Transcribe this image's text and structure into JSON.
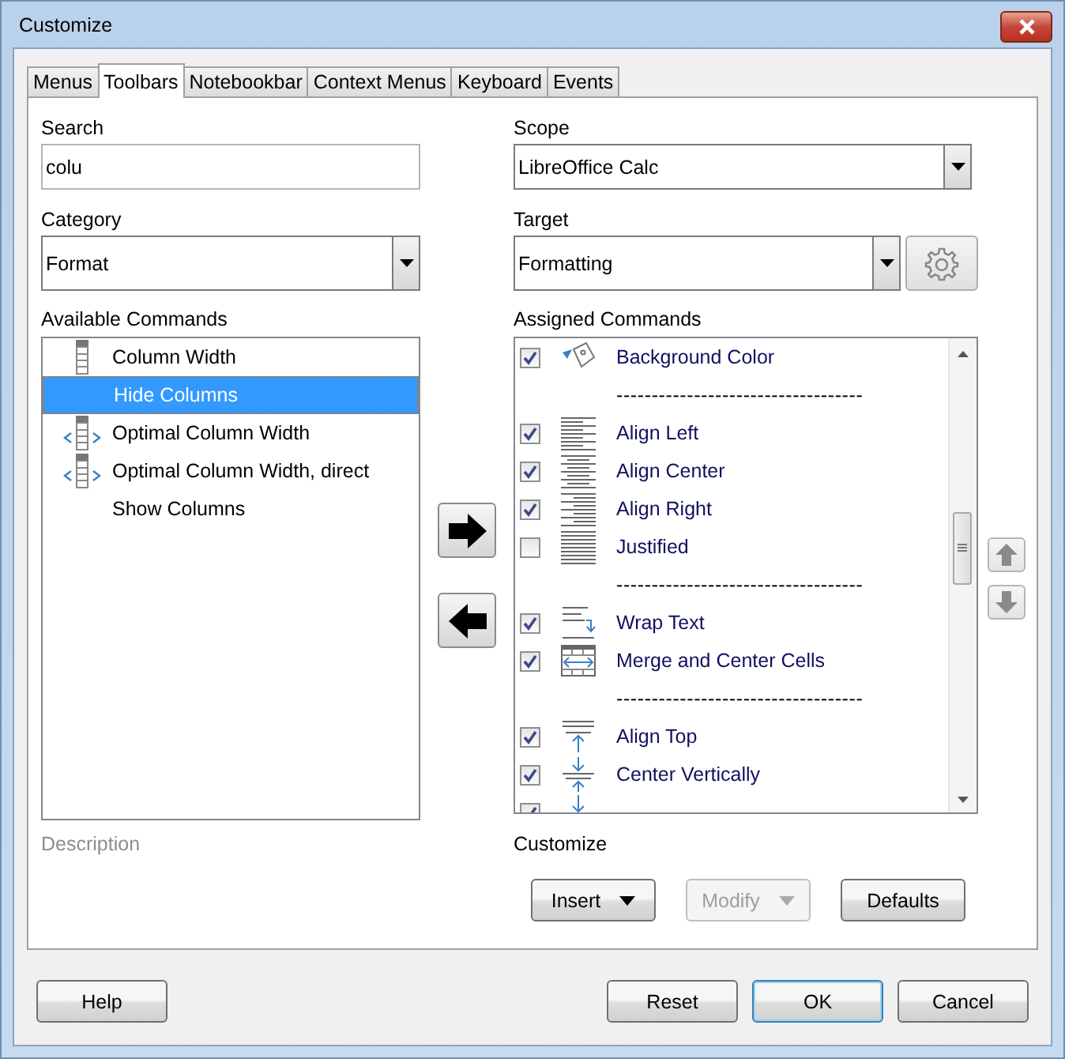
{
  "window": {
    "title": "Customize"
  },
  "tabs": [
    {
      "label": "Menus",
      "selected": false
    },
    {
      "label": "Toolbars",
      "selected": true
    },
    {
      "label": "Notebookbar",
      "selected": false
    },
    {
      "label": "Context Menus",
      "selected": false
    },
    {
      "label": "Keyboard",
      "selected": false
    },
    {
      "label": "Events",
      "selected": false
    }
  ],
  "search": {
    "label": "Search",
    "value": "colu"
  },
  "category": {
    "label": "Category",
    "value": "Format"
  },
  "available_commands": {
    "label": "Available Commands",
    "items": [
      {
        "label": "Column Width",
        "selected": false
      },
      {
        "label": "Hide Columns",
        "selected": true
      },
      {
        "label": "Optimal Column Width",
        "selected": false
      },
      {
        "label": "Optimal Column Width, direct",
        "selected": false
      },
      {
        "label": "Show Columns",
        "selected": false
      }
    ]
  },
  "description": {
    "label": "Description",
    "disabled": true
  },
  "scope": {
    "label": "Scope",
    "value": "LibreOffice Calc"
  },
  "target": {
    "label": "Target",
    "value": "Formatting"
  },
  "assigned_commands": {
    "label": "Assigned Commands",
    "items": [
      {
        "kind": "command",
        "label": "Background Color",
        "checked": true
      },
      {
        "kind": "separator",
        "label": "-----------------------------------"
      },
      {
        "kind": "command",
        "label": "Align Left",
        "checked": true
      },
      {
        "kind": "command",
        "label": "Align Center",
        "checked": true
      },
      {
        "kind": "command",
        "label": "Align Right",
        "checked": true
      },
      {
        "kind": "command",
        "label": "Justified",
        "checked": false
      },
      {
        "kind": "separator",
        "label": "-----------------------------------"
      },
      {
        "kind": "command",
        "label": "Wrap Text",
        "checked": true
      },
      {
        "kind": "command",
        "label": "Merge and Center Cells",
        "checked": true
      },
      {
        "kind": "separator",
        "label": "-----------------------------------"
      },
      {
        "kind": "command",
        "label": "Align Top",
        "checked": true
      },
      {
        "kind": "command",
        "label": "Center Vertically",
        "checked": true
      },
      {
        "kind": "command",
        "checked": true
      }
    ]
  },
  "customize": {
    "label": "Customize",
    "buttons": [
      {
        "label": "Insert",
        "menu": true,
        "disabled": false
      },
      {
        "label": "Modify",
        "menu": true,
        "disabled": true
      },
      {
        "label": "Defaults",
        "menu": false,
        "disabled": false
      }
    ]
  },
  "help_button": {
    "label": "Help"
  },
  "buttons": [
    {
      "label": "Reset",
      "default": false
    },
    {
      "label": "OK",
      "default": true
    },
    {
      "label": "Cancel",
      "default": false
    }
  ]
}
